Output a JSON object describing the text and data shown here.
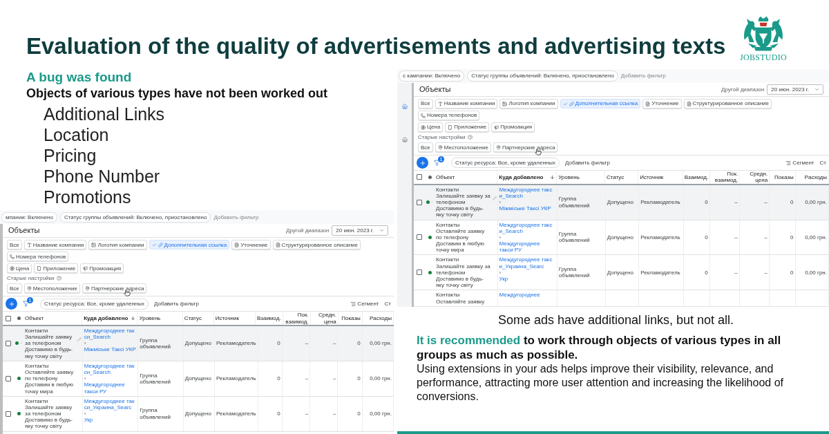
{
  "title": "Evaluation of the quality of advertisements and advertising texts",
  "logo": {
    "text": "JOBSTUDIO"
  },
  "bug": {
    "heading": "A bug was found",
    "subheading": "Objects of various types have not been worked out"
  },
  "missing_types": [
    "Additional Links",
    "Location",
    "Pricing",
    "Phone Number",
    "Promotions"
  ],
  "screenshots": [
    {
      "top_filters": [
        "мпании: Включено",
        "Статус группы объявлений: Включено, приостановлено"
      ],
      "add_filter_top": "Добавить фильтр",
      "title": "Объекты",
      "range_label": "Другой диапазон",
      "date": "20 июн. 2023 г.",
      "chips": [
        {
          "label": "Все",
          "selected": false
        },
        {
          "label": "Название компании",
          "selected": false
        },
        {
          "label": "Логотип компании",
          "selected": false
        },
        {
          "label": "Дополнительная ссылка",
          "selected": true
        },
        {
          "label": "Уточнение",
          "selected": false
        },
        {
          "label": "Структурированное описание",
          "selected": false
        },
        {
          "label": "Номера телефонов",
          "selected": false
        }
      ],
      "chips2": [
        {
          "label": "Цена",
          "selected": false
        },
        {
          "label": "Приложение",
          "selected": false
        },
        {
          "label": "Промоакция",
          "selected": false
        }
      ],
      "old_settings": "Старые настройки",
      "old_chips": [
        {
          "label": "Все",
          "selected": false
        },
        {
          "label": "Местоположение",
          "selected": false
        },
        {
          "label": "Партнерские адреса",
          "selected": false
        }
      ],
      "filter_badge": "1",
      "resource_filter": "Статус ресурса: Все, кроме удаленных",
      "add_filter": "Добавить фильтр",
      "segment": "Сегмент",
      "columns_button": "Ст",
      "columns": [
        "Объект",
        "Куда добавлено",
        "Уровень",
        "Статус",
        "Источник",
        "Взаимод.",
        "Пок. взаимод.",
        "Средн. цена",
        "Показы",
        "Расходы"
      ],
      "rows": [
        {
          "highlighted": true,
          "checked": false,
          "color": "#188038",
          "object": [
            "Контакти",
            "Залишайте заявку за телефоном",
            "Доставимо в будь-яку точку світу"
          ],
          "campaign": "Междугороднее такси_Search",
          "separator": "›",
          "group": "Міжміське Таксі УКР",
          "tier": "Группа объявлений",
          "status": "Допущено",
          "source": "Рекламодатель",
          "values": [
            "0",
            "–",
            "–",
            "0",
            "0,00 грн."
          ]
        },
        {
          "highlighted": false,
          "checked": false,
          "color": "#188038",
          "object": [
            "Контакты",
            "Оставляйте заявку по телефону",
            "Доставим в любую точку мира"
          ],
          "campaign": "Междугороднее такси_Search",
          "separator": "›",
          "group": "Междугороднее такси РУ",
          "tier": "Группа объявлений",
          "status": "Допущено",
          "source": "Рекламодатель",
          "values": [
            "0",
            "–",
            "–",
            "0",
            "0,00 грн."
          ]
        },
        {
          "highlighted": false,
          "checked": false,
          "color": "#188038",
          "object": [
            "Контакти",
            "Залишайте заявку за телефоном",
            "Доставимо в будь-яку точку світу"
          ],
          "campaign": "Междугороднее такси_Украина_Searc",
          "separator": "›",
          "group": "Укр",
          "tier": "Группа объявлений",
          "status": "Допущено",
          "source": "Рекламодатель",
          "values": [
            "0",
            "–",
            "–",
            "0",
            "0,00 грн."
          ]
        }
      ],
      "select_all_checked": false
    },
    {
      "top_filters": [
        "с кампании: Включено",
        "Статус группы объявлений: Включено, приостановлено"
      ],
      "add_filter_top": "Добавить фильтр",
      "title": "Объекты",
      "range_label": "Другой диапазон",
      "date": "20 июн. 2023 г.",
      "chips": [
        {
          "label": "Все",
          "selected": false
        },
        {
          "label": "Название компании",
          "selected": false
        },
        {
          "label": "Логотип компании",
          "selected": false
        },
        {
          "label": "Дополнительная ссылка",
          "selected": true
        },
        {
          "label": "Уточнение",
          "selected": false
        },
        {
          "label": "Структурированное описание",
          "selected": false
        },
        {
          "label": "Номера телефонов",
          "selected": false
        }
      ],
      "chips2": [
        {
          "label": "Цена",
          "selected": false
        },
        {
          "label": "Приложение",
          "selected": false
        },
        {
          "label": "Промоакция",
          "selected": false
        }
      ],
      "old_settings": "Старые настройки",
      "old_chips": [
        {
          "label": "Все",
          "selected": false
        },
        {
          "label": "Местоположение",
          "selected": false
        },
        {
          "label": "Партнерские адреса",
          "selected": false
        }
      ],
      "filter_badge": "1",
      "resource_filter": "Статус ресурса: Все, кроме удаленных",
      "add_filter": "Добавить фильтр",
      "segment": "Сегмент",
      "columns_button": "Ст",
      "columns": [
        "Объект",
        "Куда добавлено",
        "Уровень",
        "Статус",
        "Источник",
        "Взаимод.",
        "Пок. взаимод.",
        "Средн. цена",
        "Показы",
        "Расходы"
      ],
      "rows": [
        {
          "highlighted": true,
          "checked": false,
          "color": "#188038",
          "object": [
            "Контакти",
            "Залишайте заявку за телефоном",
            "Доставимо в будь-яку точку світу"
          ],
          "campaign": "Междугороднее такси_Search",
          "separator": "›",
          "group": "Міжміське Таксі УКР",
          "tier": "Группа объявлений",
          "status": "Допущено",
          "source": "Рекламодатель",
          "values": [
            "0",
            "–",
            "–",
            "0",
            "0,00 грн."
          ]
        },
        {
          "highlighted": false,
          "checked": false,
          "color": "#188038",
          "object": [
            "Контакты",
            "Оставляйте заявку по телефону",
            "Доставим в любую точку мира"
          ],
          "campaign": "Междугороднее такси_Search",
          "separator": "›",
          "group": "Междугороднее такси РУ",
          "tier": "Группа объявлений",
          "status": "Допущено",
          "source": "Рекламодатель",
          "values": [
            "0",
            "–",
            "–",
            "0",
            "0,00 грн."
          ]
        },
        {
          "highlighted": false,
          "checked": false,
          "color": "#188038",
          "object": [
            "Контакти",
            "Залишайте заявку за телефоном",
            "Доставимо в будь-яку точку світу"
          ],
          "campaign": "Междугороднее такси_Украина_Searc",
          "separator": "›",
          "group": "Укр",
          "tier": "Группа объявлений",
          "status": "Допущено",
          "source": "Рекламодатель",
          "values": [
            "0",
            "–",
            "–",
            "0",
            "0,00 грн."
          ]
        },
        {
          "highlighted": false,
          "object": [
            "Контакты",
            "Оставляйте заявку"
          ],
          "campaign": "Междугороднее"
        }
      ],
      "select_all_checked": false
    }
  ],
  "note": "Some ads have additional links, but not all.",
  "recommendation": {
    "highlight": "It is recommended",
    "text": "to work through objects of various types in all groups as much as possible."
  },
  "explanation": "Using extensions in your ads helps improve their visibility, relevance, and performance, attracting more user attention and increasing the likelihood of conversions."
}
